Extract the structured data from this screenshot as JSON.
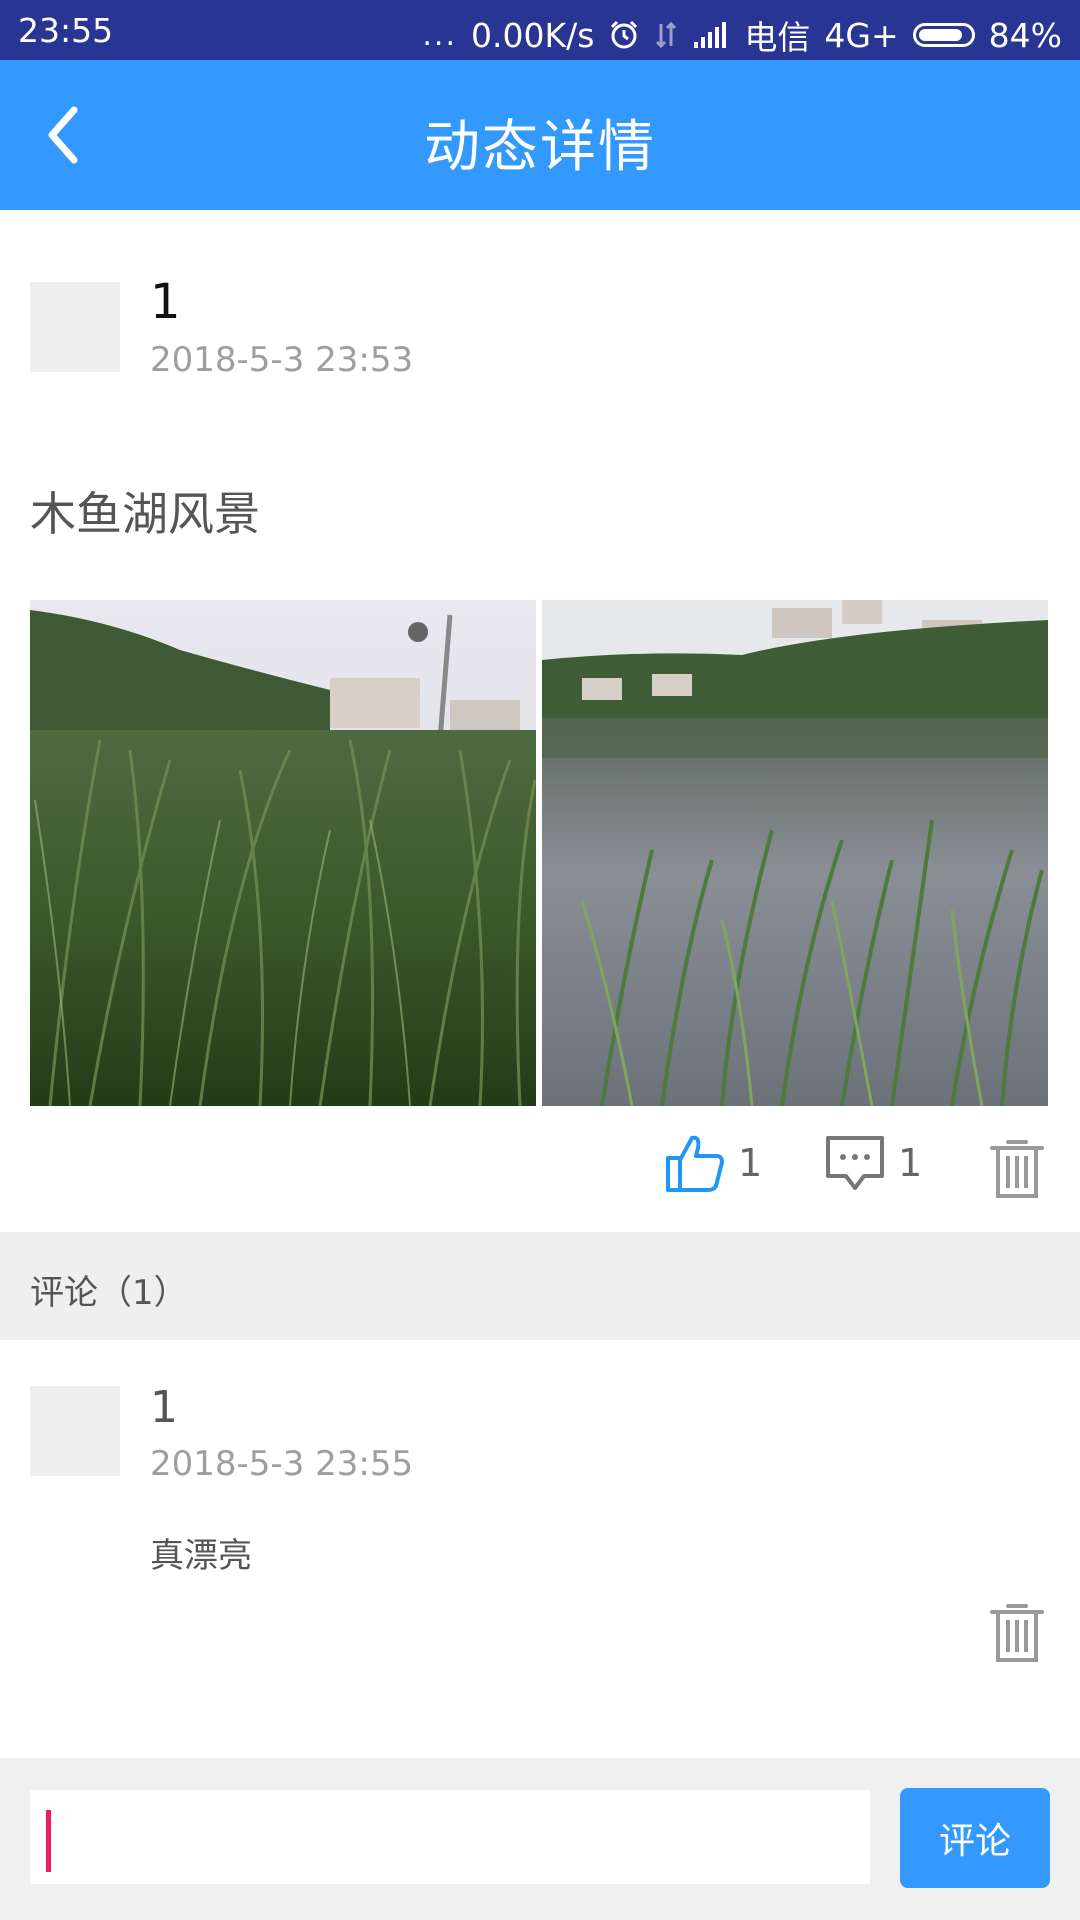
{
  "status_bar": {
    "time": "23:55",
    "dots": "...",
    "network_speed": "0.00K/s",
    "carrier": "电信",
    "network_type": "4G+",
    "battery": "84%"
  },
  "app_bar": {
    "title": "动态详情",
    "back_icon": "chevron-left-icon"
  },
  "post": {
    "author": "1",
    "time": "2018-5-3 23:53",
    "text": "木鱼湖风景",
    "photos": [
      {
        "name": "reeds-closeup-photo"
      },
      {
        "name": "lake-view-photo"
      }
    ],
    "likes": "1",
    "comments": "1"
  },
  "comments_section": {
    "header": "评论（1）",
    "items": [
      {
        "author": "1",
        "time": "2018-5-3 23:55",
        "text": "真漂亮"
      }
    ]
  },
  "input": {
    "value": "",
    "placeholder": "",
    "submit_label": "评论"
  },
  "colors": {
    "status_bar": "#283593",
    "primary": "#3399ff",
    "caret": "#e91e63"
  }
}
